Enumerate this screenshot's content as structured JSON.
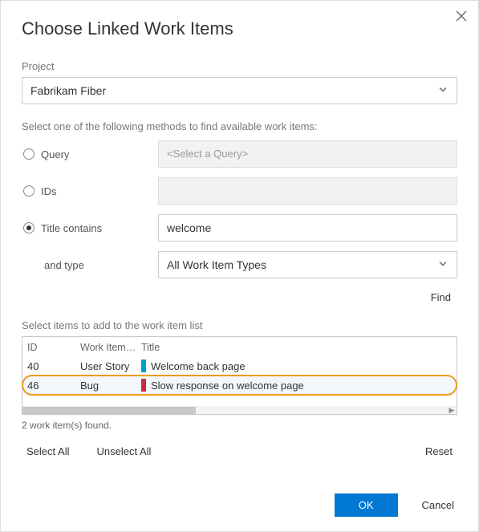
{
  "title": "Choose Linked Work Items",
  "project_label": "Project",
  "project_value": "Fabrikam Fiber",
  "method_instruction": "Select one of the following methods to find available work items:",
  "methods": {
    "query_label": "Query",
    "query_placeholder": "<Select a Query>",
    "ids_label": "IDs",
    "title_label": "Title contains",
    "title_value": "welcome",
    "type_label": "and type",
    "type_value": "All Work Item Types"
  },
  "find_label": "Find",
  "list_instruction": "Select items to add to the work item list",
  "columns": {
    "id": "ID",
    "type": "Work Item…",
    "title": "Title"
  },
  "rows": [
    {
      "id": "40",
      "type": "User Story",
      "title": "Welcome back page",
      "color": "blue",
      "selected": false
    },
    {
      "id": "46",
      "type": "Bug",
      "title": "Slow response on welcome page",
      "color": "red",
      "selected": true
    }
  ],
  "count_text": "2 work item(s) found.",
  "select_all": "Select All",
  "unselect_all": "Unselect All",
  "reset": "Reset",
  "ok": "OK",
  "cancel": "Cancel"
}
